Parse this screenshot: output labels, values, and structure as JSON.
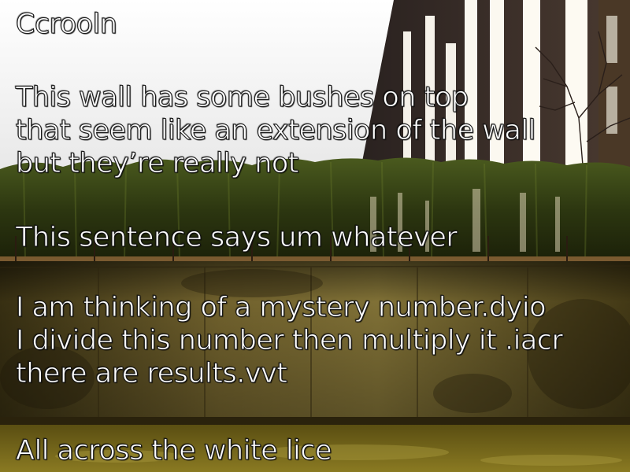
{
  "slide": {
    "title": "Ccrooln",
    "paragraphs": [
      {
        "lines": [
          "This wall has some bushes on top",
          "that seem like an extension of the wall",
          "but they’re really not"
        ]
      },
      {
        "lines": [
          "This sentence says um whatever"
        ]
      },
      {
        "lines": [
          "I am thinking of a mystery number.dyio",
          "I divide this number then multiply it .iacr",
          "there are results.vvt"
        ]
      },
      {
        "lines": [
          "All across the white lice"
        ]
      }
    ]
  },
  "scene": {
    "elements": [
      "overcast-sky",
      "building-facade-with-columns",
      "bare-tree",
      "hedge",
      "railing",
      "concrete-wall",
      "grass"
    ],
    "colors": {
      "sky": "#f2f2f2",
      "hedge": "#2f3a12",
      "wall": "#6b5a24",
      "grass": "#7a6a1a",
      "building": "#3a2f2a",
      "text": "#ffffff"
    }
  }
}
